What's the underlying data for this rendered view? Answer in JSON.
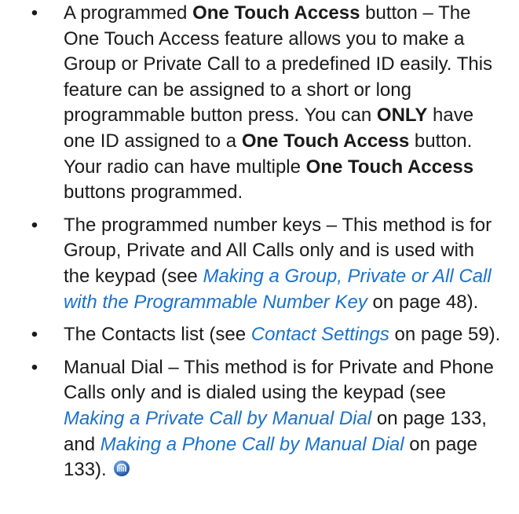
{
  "bullet_char": "•",
  "accent_color": "#1a72c9",
  "items": [
    {
      "lead": "A programmed ",
      "b1": "One Touch Access",
      "t1": " button – The One Touch Access feature allows you to make a Group or Private Call to a predefined ID easily. This feature can be assigned to a short or long programmable button press. You can ",
      "b2": "ONLY",
      "t2": " have one ID assigned to a ",
      "b3": "One Touch Access",
      "t3": " button. Your radio can have multiple ",
      "b4": "One Touch Access",
      "t4": " buttons programmed."
    },
    {
      "lead": "The programmed number keys – This method is for Group, Private and All Calls only and is used with the keypad (see ",
      "link": "Making a Group, Private or All Call with the Programmable Number Key",
      "tail": " on page 48)."
    },
    {
      "lead": "The Contacts list (see ",
      "link": "Contact Settings",
      "tail": " on page 59)."
    },
    {
      "lead": "Manual Dial – This method is for Private and Phone Calls only and is dialed using the keypad (see ",
      "link1": "Making a Private Call by Manual Dial",
      "mid": " on page 133, and ",
      "link2": "Making a Phone Call by Manual Dial",
      "tail": " on page 133).",
      "end_icon": "end-of-section-icon"
    }
  ]
}
